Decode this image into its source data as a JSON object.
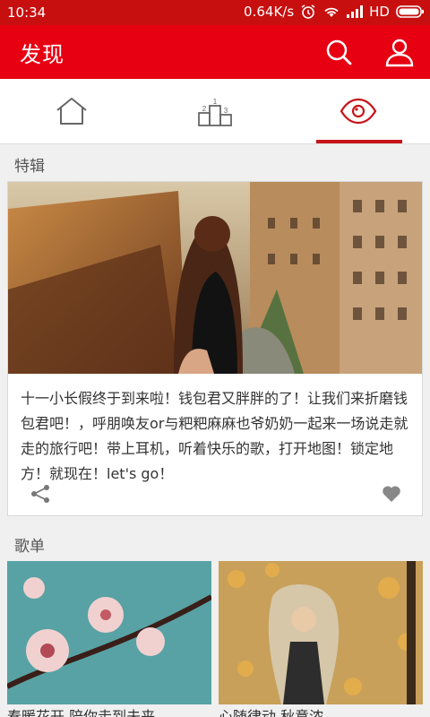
{
  "status": {
    "time": "10:34",
    "speed": "0.64K/s",
    "network": "HD"
  },
  "appbar": {
    "title": "发现"
  },
  "tabs": [
    {
      "name": "home",
      "icon": "home-icon"
    },
    {
      "name": "ranking",
      "icon": "podium-icon",
      "podium_labels": [
        "1",
        "2",
        "3"
      ]
    },
    {
      "name": "discover",
      "icon": "eye-icon",
      "active": true
    }
  ],
  "feature": {
    "section_title": "特辑",
    "description": "十一小长假终于到来啦！钱包君又胖胖的了！让我们来折磨钱包君吧！，呼朋唤友or与粑粑麻麻也爷奶奶一起来一场说走就走的旅行吧！带上耳机，听着快乐的歌，打开地图！锁定地方！就现在！let's go！"
  },
  "playlists": {
    "section_title": "歌单",
    "items": [
      {
        "caption": "春暖花开 陪你走到未来"
      },
      {
        "caption": "心随律动 秋意浓"
      }
    ]
  },
  "colors": {
    "primary": "#e60012",
    "status": "#c70f0f",
    "accent_underline": "#c7141a"
  }
}
